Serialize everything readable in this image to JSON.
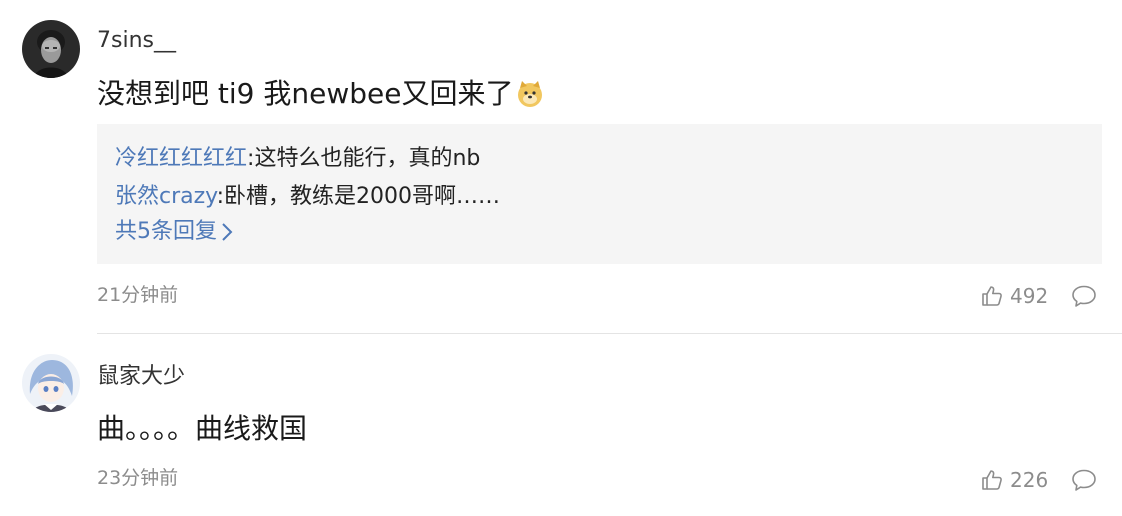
{
  "comments": [
    {
      "avatar_icon": "avatar-portrait-dark",
      "username": "7sins__",
      "text": "没想到吧 ti9 我newbee又回来了",
      "emoji_icon": "doge-emoji-icon",
      "replies": [
        {
          "author": "冷红红红红红",
          "separator": ":",
          "text": "这特么也能行，真的nb"
        },
        {
          "author": "张然crazy",
          "separator": ":",
          "text": "卧槽，教练是2000哥啊……"
        }
      ],
      "more_replies_label": "共5条回复",
      "time": "21分钟前",
      "likes": "492"
    },
    {
      "avatar_icon": "avatar-anime-girl",
      "username": "鼠家大少",
      "text": "曲。。。。曲线救国",
      "time": "23分钟前",
      "likes": "226"
    }
  ],
  "colors": {
    "link_blue": "#4e79b8",
    "meta_gray": "#8c8c8c",
    "reply_bg": "#f5f5f5"
  },
  "icons": {
    "like": "thumbs-up-icon",
    "reply": "speech-bubble-icon",
    "more": "chevron-right-icon"
  }
}
